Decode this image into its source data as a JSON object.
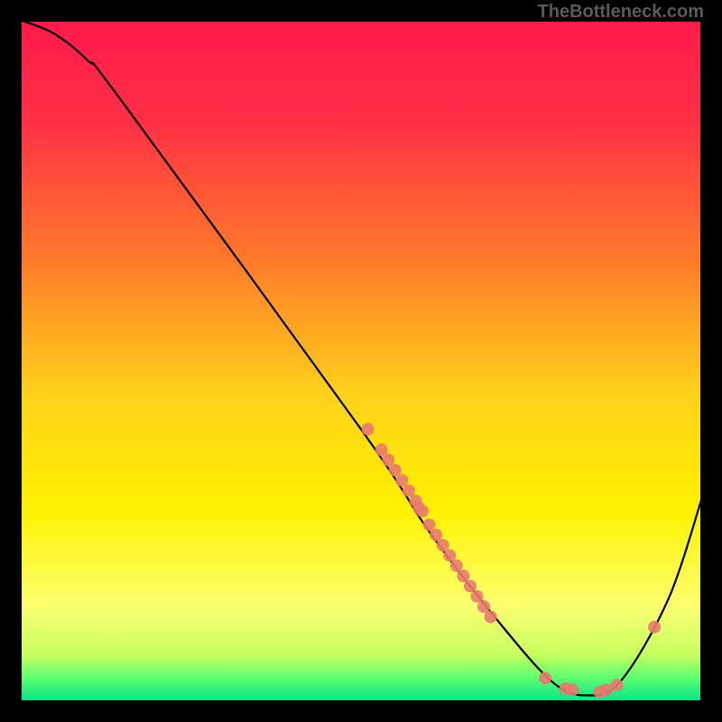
{
  "watermark": "TheBottleneck.com",
  "chart_data": {
    "type": "line",
    "title": "",
    "xlabel": "",
    "ylabel": "",
    "xlim": [
      0,
      100
    ],
    "ylim": [
      0,
      100
    ],
    "curve": [
      [
        0,
        100
      ],
      [
        5,
        98
      ],
      [
        10,
        94
      ],
      [
        15,
        88
      ],
      [
        50,
        40
      ],
      [
        60,
        25
      ],
      [
        70,
        12
      ],
      [
        78,
        3
      ],
      [
        83,
        1
      ],
      [
        88,
        3
      ],
      [
        95,
        15
      ],
      [
        100,
        30
      ]
    ],
    "markers": [
      [
        51,
        40
      ],
      [
        53,
        37
      ],
      [
        54,
        35.5
      ],
      [
        55,
        34
      ],
      [
        56,
        32.5
      ],
      [
        57,
        31
      ],
      [
        58,
        29.5
      ],
      [
        58.5,
        28.5
      ],
      [
        59,
        28
      ],
      [
        60,
        26
      ],
      [
        61,
        24.5
      ],
      [
        62,
        23
      ],
      [
        63,
        21.5
      ],
      [
        64,
        20
      ],
      [
        65,
        18.5
      ],
      [
        66,
        17
      ],
      [
        67,
        15.5
      ],
      [
        68,
        14
      ],
      [
        69,
        12.5
      ],
      [
        77,
        3.5
      ],
      [
        80,
        2
      ],
      [
        81,
        1.8
      ],
      [
        85,
        1.5
      ],
      [
        86,
        1.8
      ],
      [
        87.5,
        2.5
      ],
      [
        93,
        11
      ]
    ],
    "gradient_stops": [
      {
        "offset": 0,
        "color": "#ff1a4a"
      },
      {
        "offset": 0.15,
        "color": "#ff3045"
      },
      {
        "offset": 0.35,
        "color": "#ff7a2a"
      },
      {
        "offset": 0.55,
        "color": "#ffd21a"
      },
      {
        "offset": 0.72,
        "color": "#fff200"
      },
      {
        "offset": 0.86,
        "color": "#fbff70"
      },
      {
        "offset": 0.93,
        "color": "#c8ff60"
      },
      {
        "offset": 0.965,
        "color": "#5cff70"
      },
      {
        "offset": 1.0,
        "color": "#00e38a"
      }
    ],
    "marker_color": "#e97a6f",
    "curve_color": "#000000"
  }
}
